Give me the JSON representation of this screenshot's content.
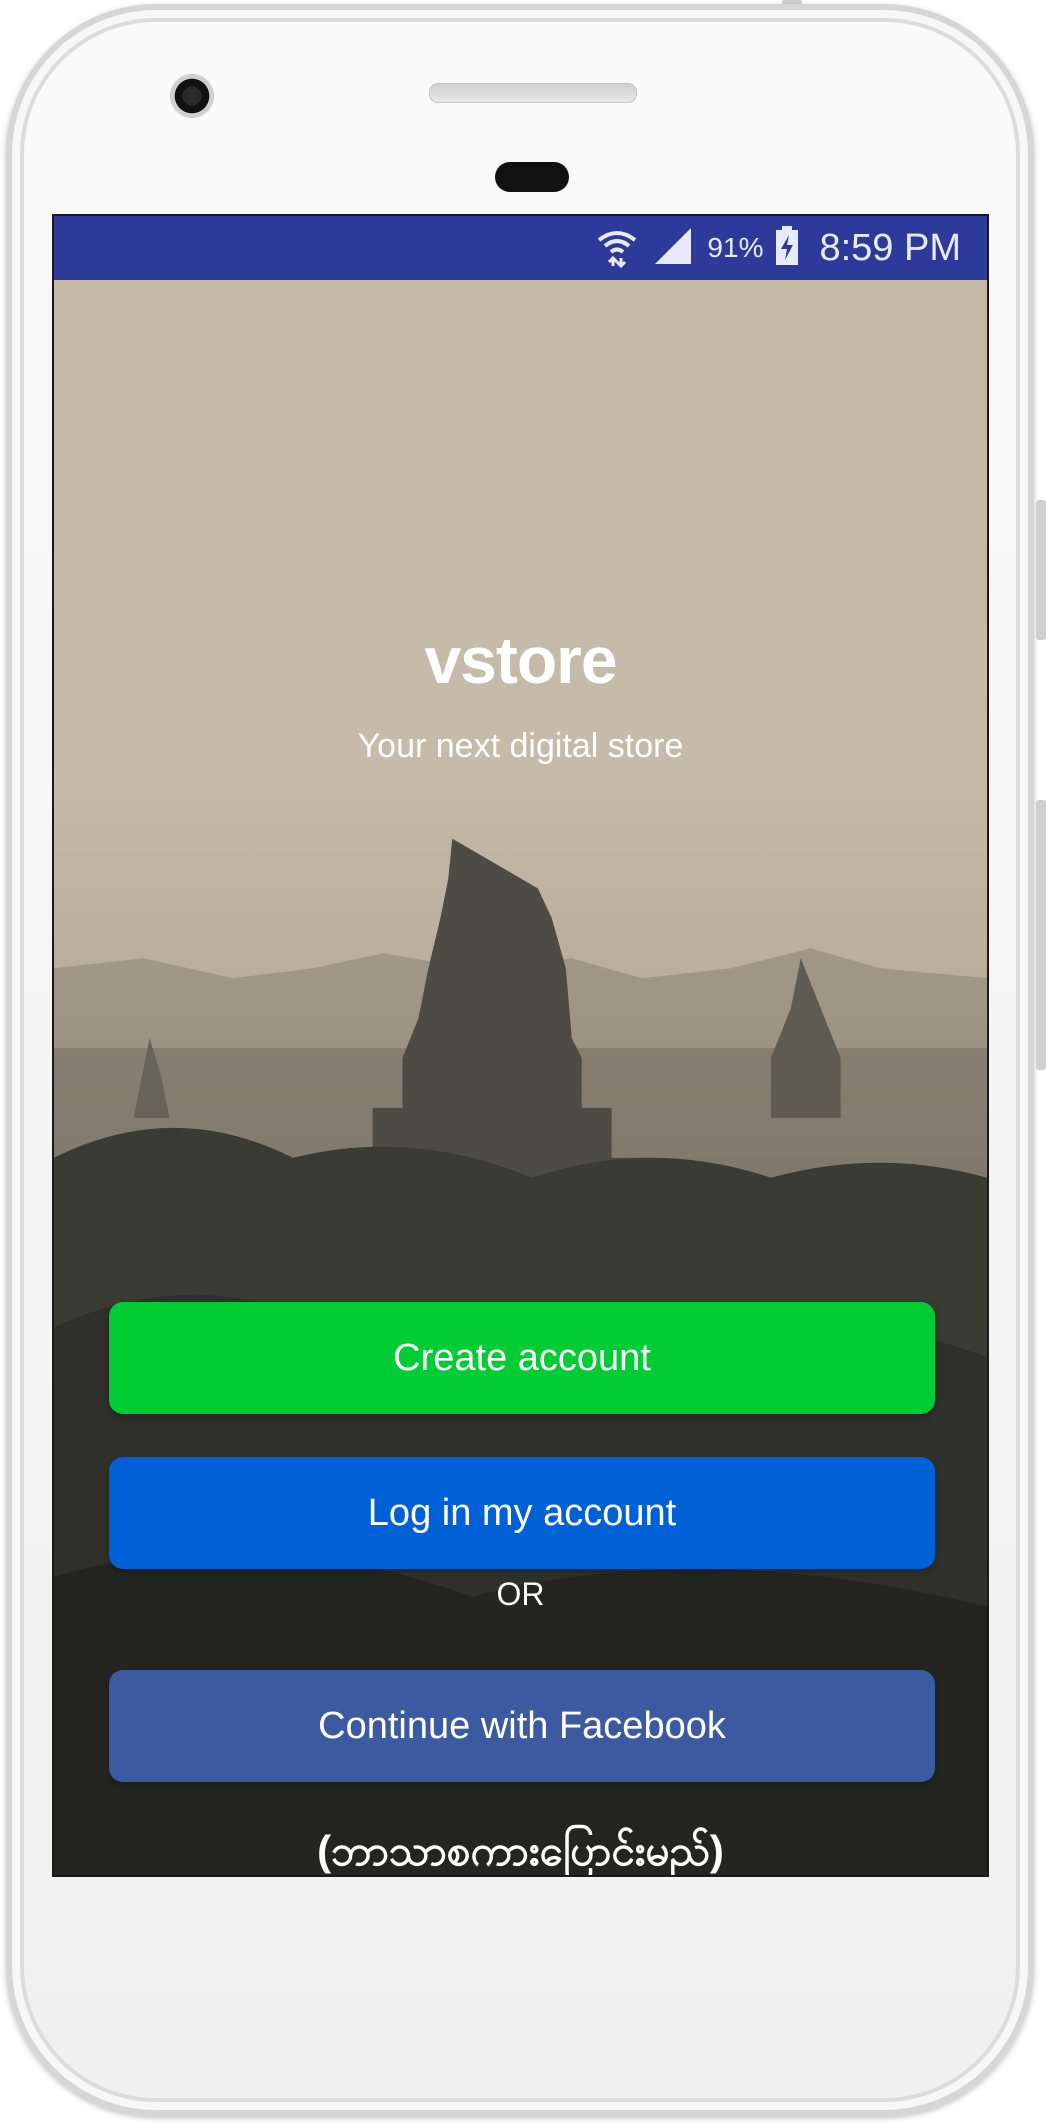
{
  "status_bar": {
    "icons": [
      "wifi-icon",
      "signal-icon",
      "battery-charging-icon"
    ],
    "battery_percent": "91%",
    "time": "8:59 PM",
    "background_color": "#2e3a9a"
  },
  "hero": {
    "app_name": "vstore",
    "tagline": "Your next digital store"
  },
  "actions": {
    "create_account_label": "Create account",
    "login_label": "Log in my account",
    "divider_label": "OR",
    "facebook_label": "Continue with Facebook"
  },
  "language_switch": {
    "label": "(ဘာသာစကားပြောင်းမည်)"
  },
  "colors": {
    "create_button": "#00cc33",
    "login_button": "#0060d6",
    "facebook_button": "#3b5aa0"
  }
}
